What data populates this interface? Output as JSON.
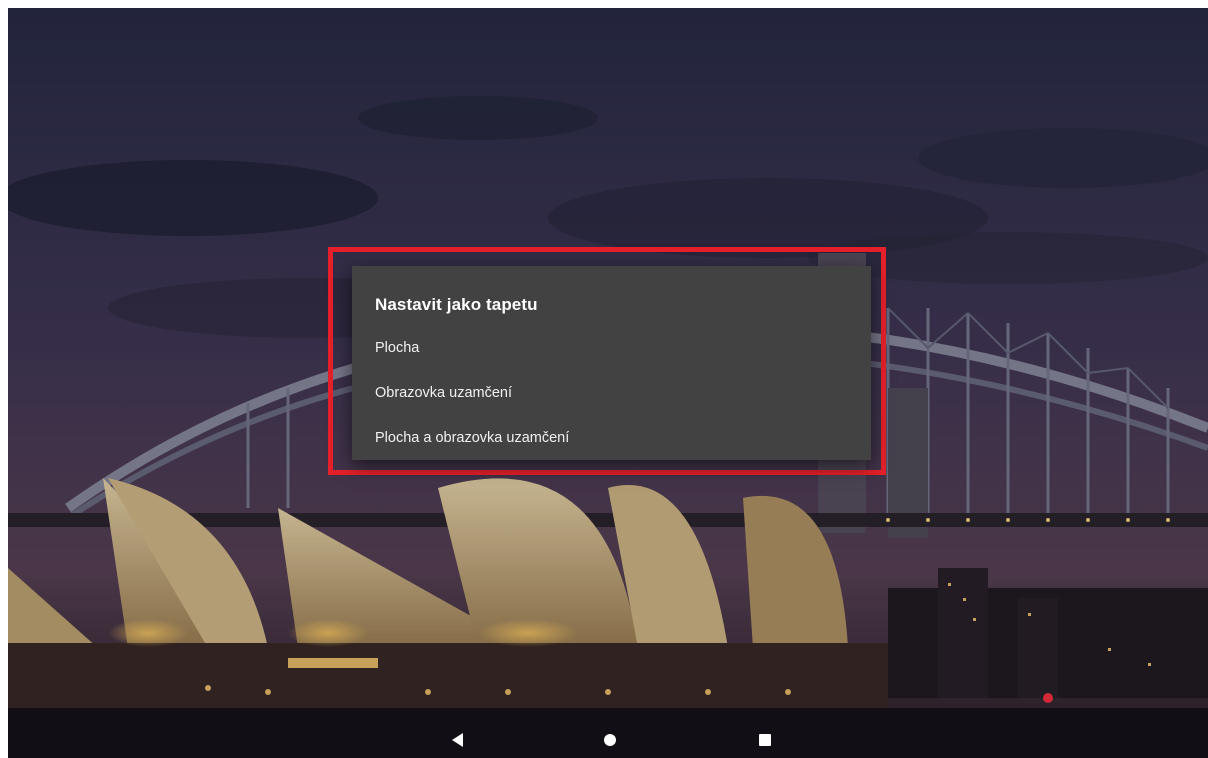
{
  "dialog": {
    "title": "Nastavit jako tapetu",
    "options": [
      {
        "label": "Plocha"
      },
      {
        "label": "Obrazovka uzamčení"
      },
      {
        "label": "Plocha a obrazovka uzamčení"
      }
    ]
  },
  "highlight_color": "#e5202a",
  "dialog_background": "#424242",
  "navigation": {
    "icons": [
      "back-icon",
      "home-icon",
      "recents-icon"
    ]
  }
}
